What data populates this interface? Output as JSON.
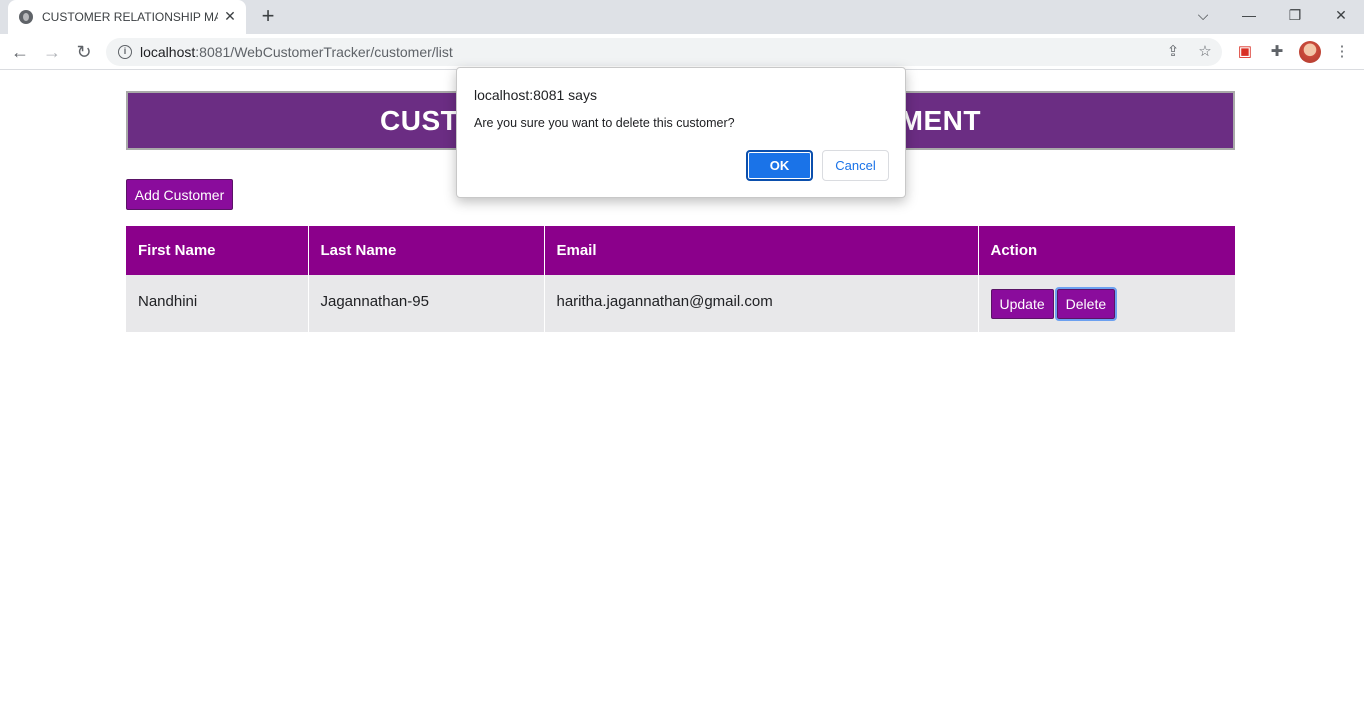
{
  "browser": {
    "tab_title": "CUSTOMER RELATIONSHIP MANAGEMENT",
    "url_host": "localhost",
    "url_rest": ":8081/WebCustomerTracker/customer/list"
  },
  "page": {
    "banner_title": "CUSTOMER RELATIONSHIP MANAGEMENT",
    "add_button": "Add Customer",
    "table": {
      "headers": [
        "First Name",
        "Last Name",
        "Email",
        "Action"
      ],
      "rows": [
        {
          "first_name": "Nandhini",
          "last_name": "Jagannathan-95",
          "email": "haritha.jagannathan@gmail.com",
          "update_label": "Update",
          "delete_label": "Delete"
        }
      ]
    }
  },
  "dialog": {
    "origin": "localhost:8081 says",
    "message": "Are you sure you want to delete this customer?",
    "ok_label": "OK",
    "cancel_label": "Cancel"
  },
  "colors": {
    "banner": "#6b2d83",
    "header": "#8b008b",
    "button": "#8a0c9c",
    "dialog_ok": "#1a73e8"
  }
}
